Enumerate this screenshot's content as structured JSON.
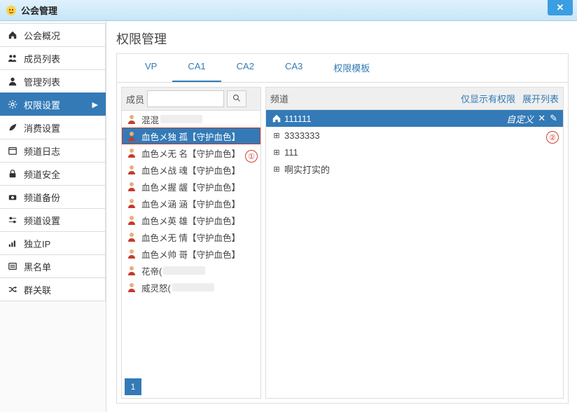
{
  "window": {
    "title": "公会管理",
    "close_glyph": "✕"
  },
  "sidebar": {
    "items": [
      {
        "icon": "home",
        "label": "公会概况"
      },
      {
        "icon": "users",
        "label": "成员列表"
      },
      {
        "icon": "user",
        "label": "管理列表"
      },
      {
        "icon": "gear",
        "label": "权限设置",
        "active": true
      },
      {
        "icon": "leaf",
        "label": "消费设置"
      },
      {
        "icon": "cal",
        "label": "频道日志"
      },
      {
        "icon": "lock",
        "label": "频道安全"
      },
      {
        "icon": "camera",
        "label": "频道备份"
      },
      {
        "icon": "sliders",
        "label": "频道设置"
      },
      {
        "icon": "signal",
        "label": "独立IP"
      },
      {
        "icon": "list",
        "label": "黑名单"
      },
      {
        "icon": "shuffle",
        "label": "群关联"
      }
    ]
  },
  "page": {
    "title": "权限管理"
  },
  "tabs": [
    {
      "label": "VP"
    },
    {
      "label": "CA1",
      "active": true
    },
    {
      "label": "CA2"
    },
    {
      "label": "CA3"
    },
    {
      "label": "权限模板"
    }
  ],
  "members_panel": {
    "head_label": "成员",
    "search_placeholder": "",
    "search_icon": "search",
    "members": [
      {
        "name": "混混",
        "blur": true
      },
      {
        "name": "血色メ独  孤【守护血色】",
        "selected": true
      },
      {
        "name": "血色メ无  名【守护血色】"
      },
      {
        "name": "血色メ战  魂【守护血色】"
      },
      {
        "name": "血色メ握  龌【守护血色】"
      },
      {
        "name": "血色メ涵  涵【守护血色】"
      },
      {
        "name": "血色メ英  雄【守护血色】"
      },
      {
        "name": "血色メ无  情【守护血色】"
      },
      {
        "name": "血色メ帅  哥【守护血色】"
      },
      {
        "name": "花帝(",
        "blur": true
      },
      {
        "name": "威灵怒(",
        "blur": true
      }
    ],
    "pager": "1"
  },
  "channels_panel": {
    "head_label": "频道",
    "head_links": {
      "filter": "仅显示有权限",
      "expand": "展开列表"
    },
    "tree": [
      {
        "label": "111111",
        "root": true,
        "selected": true,
        "custom_label": "自定义",
        "home_icon": "home",
        "close_icon": "✕",
        "edit_icon": "✎"
      },
      {
        "label": "3333333",
        "toggle": "⊞"
      },
      {
        "label": "111",
        "toggle": "⊞"
      },
      {
        "label": "啊实打实的",
        "toggle": "⊞"
      }
    ]
  },
  "callouts": {
    "one": "①",
    "two": "②"
  }
}
